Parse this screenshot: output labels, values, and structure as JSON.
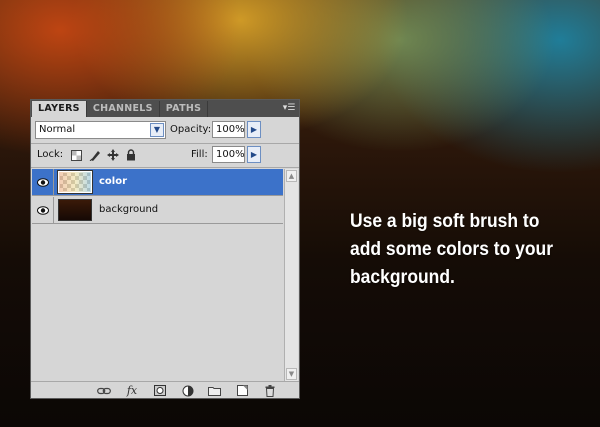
{
  "panel": {
    "tabs": [
      {
        "label": "LAYERS",
        "active": true
      },
      {
        "label": "CHANNELS",
        "active": false
      },
      {
        "label": "PATHS",
        "active": false
      }
    ],
    "menu_icon": "panel-menu-icon",
    "blend_mode": "Normal",
    "opacity_label": "Opacity:",
    "opacity_value": "100%",
    "lock_label": "Lock:",
    "lock_icons": [
      "lock-transparency-icon",
      "lock-pixels-icon",
      "lock-position-icon",
      "lock-all-icon"
    ],
    "fill_label": "Fill:",
    "fill_value": "100%",
    "layers": [
      {
        "name": "color",
        "visible": true,
        "selected": true
      },
      {
        "name": "background",
        "visible": true,
        "selected": false
      }
    ],
    "bottom_icons": [
      "link-layers-icon",
      "fx-icon",
      "add-mask-icon",
      "adjustment-layer-icon",
      "new-group-icon",
      "new-layer-icon",
      "delete-layer-icon"
    ]
  },
  "caption": {
    "line1": "Use a big soft brush to",
    "line2": "add some colors to your",
    "line3": "background."
  },
  "colors": {
    "selection": "#3c72c9",
    "panel_bg": "#d6d6d6",
    "tab_bar": "#4e4e4e"
  }
}
